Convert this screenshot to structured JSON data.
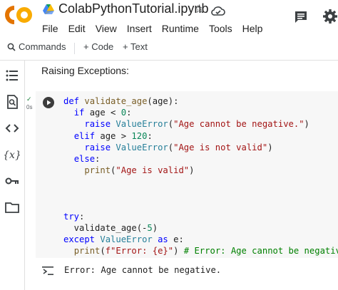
{
  "header": {
    "logo_text": "CO",
    "notebook_title": "ColabPythonTutorial.ipynb",
    "menu": [
      "File",
      "Edit",
      "View",
      "Insert",
      "Runtime",
      "Tools",
      "Help"
    ]
  },
  "toolbar": {
    "commands_label": "Commands",
    "add_code_label": "+ Code",
    "add_text_label": "+ Text"
  },
  "sidebar": {
    "icons": [
      "table-of-contents-icon",
      "find-icon",
      "code-snippets-icon",
      "variables-icon",
      "secrets-key-icon",
      "files-folder-icon"
    ]
  },
  "notebook": {
    "text_cell": "Raising Exceptions:",
    "code_cell": {
      "exec_status": "✓",
      "exec_time": "0s",
      "lines": [
        [
          {
            "t": "def",
            "c": "kw"
          },
          {
            "t": " "
          },
          {
            "t": "validate_age",
            "c": "bi"
          },
          {
            "t": "(age):"
          }
        ],
        [
          {
            "t": "  "
          },
          {
            "t": "if",
            "c": "kw"
          },
          {
            "t": " age < "
          },
          {
            "t": "0",
            "c": "num"
          },
          {
            "t": ":"
          }
        ],
        [
          {
            "t": "    "
          },
          {
            "t": "raise",
            "c": "kw"
          },
          {
            "t": " "
          },
          {
            "t": "ValueError",
            "c": "cls"
          },
          {
            "t": "("
          },
          {
            "t": "\"Age cannot be negative.\"",
            "c": "str"
          },
          {
            "t": ")"
          }
        ],
        [
          {
            "t": "  "
          },
          {
            "t": "elif",
            "c": "kw"
          },
          {
            "t": " age > "
          },
          {
            "t": "120",
            "c": "num"
          },
          {
            "t": ":"
          }
        ],
        [
          {
            "t": "    "
          },
          {
            "t": "raise",
            "c": "kw"
          },
          {
            "t": " "
          },
          {
            "t": "ValueError",
            "c": "cls"
          },
          {
            "t": "("
          },
          {
            "t": "\"Age is not valid\"",
            "c": "str"
          },
          {
            "t": ")"
          }
        ],
        [
          {
            "t": "  "
          },
          {
            "t": "else",
            "c": "kw"
          },
          {
            "t": ":"
          }
        ],
        [
          {
            "t": "    "
          },
          {
            "t": "print",
            "c": "bi"
          },
          {
            "t": "("
          },
          {
            "t": "\"Age is valid\"",
            "c": "str"
          },
          {
            "t": ")"
          }
        ],
        [],
        [],
        [],
        [
          {
            "t": "try",
            "c": "kw"
          },
          {
            "t": ":"
          }
        ],
        [
          {
            "t": "  validate_age(-"
          },
          {
            "t": "5",
            "c": "num"
          },
          {
            "t": ")"
          }
        ],
        [
          {
            "t": "except",
            "c": "kw"
          },
          {
            "t": " "
          },
          {
            "t": "ValueError",
            "c": "cls"
          },
          {
            "t": " "
          },
          {
            "t": "as",
            "c": "kw"
          },
          {
            "t": " e:"
          }
        ],
        [
          {
            "t": "  "
          },
          {
            "t": "print",
            "c": "bi"
          },
          {
            "t": "("
          },
          {
            "t": "f\"Error: {e}\"",
            "c": "str"
          },
          {
            "t": ") "
          },
          {
            "t": "# Error: Age cannot be negative",
            "c": "cm"
          }
        ]
      ]
    },
    "output": "Error: Age cannot be negative."
  },
  "colors": {
    "logo_orange": "#f9ab00",
    "logo_dark_orange": "#e37400",
    "keyword": "#0000ff",
    "string": "#a31515",
    "number": "#098658",
    "class": "#267f99",
    "function": "#795e26",
    "comment": "#008000",
    "cell_background": "#f7f7f7"
  }
}
